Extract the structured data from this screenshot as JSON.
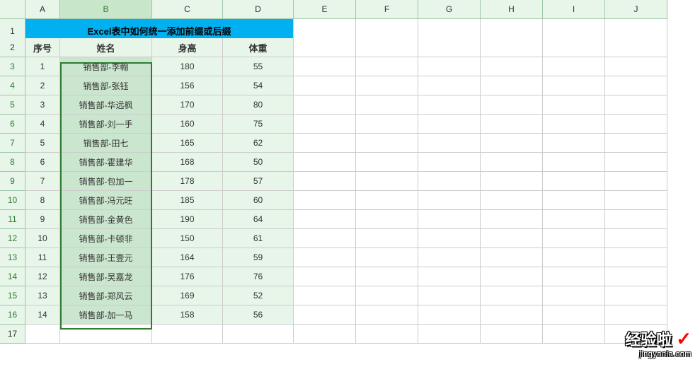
{
  "columns": [
    "A",
    "B",
    "C",
    "D",
    "E",
    "F",
    "G",
    "H",
    "I",
    "J"
  ],
  "selected_column": "B",
  "title": "Excel表中如何统一添加前缀或后缀",
  "headers": {
    "A": "序号",
    "B": "姓名",
    "C": "身高",
    "D": "体重"
  },
  "rows": [
    {
      "num": 1,
      "id": "1",
      "name": "销售部-李翰",
      "height": "180",
      "weight": "55"
    },
    {
      "num": 2,
      "id": "2",
      "name": "销售部-张钰",
      "height": "156",
      "weight": "54"
    },
    {
      "num": 3,
      "id": "3",
      "name": "销售部-华远枫",
      "height": "170",
      "weight": "80"
    },
    {
      "num": 4,
      "id": "4",
      "name": "销售部-刘一手",
      "height": "160",
      "weight": "75"
    },
    {
      "num": 5,
      "id": "5",
      "name": "销售部-田七",
      "height": "165",
      "weight": "62"
    },
    {
      "num": 6,
      "id": "6",
      "name": "销售部-霍建华",
      "height": "168",
      "weight": "50"
    },
    {
      "num": 7,
      "id": "7",
      "name": "销售部-包加一",
      "height": "178",
      "weight": "57"
    },
    {
      "num": 8,
      "id": "8",
      "name": "销售部-冯元旺",
      "height": "185",
      "weight": "60"
    },
    {
      "num": 9,
      "id": "9",
      "name": "销售部-金黄色",
      "height": "190",
      "weight": "64"
    },
    {
      "num": 10,
      "id": "10",
      "name": "销售部-卡顿非",
      "height": "150",
      "weight": "61"
    },
    {
      "num": 11,
      "id": "11",
      "name": "销售部-王壹元",
      "height": "164",
      "weight": "59"
    },
    {
      "num": 12,
      "id": "12",
      "name": "销售部-吴嘉龙",
      "height": "176",
      "weight": "76"
    },
    {
      "num": 13,
      "id": "13",
      "name": "销售部-郑风云",
      "height": "169",
      "weight": "52"
    },
    {
      "num": 14,
      "id": "14",
      "name": "销售部-加一马",
      "height": "158",
      "weight": "56"
    }
  ],
  "row_numbers": [
    1,
    2,
    3,
    4,
    5,
    6,
    7,
    8,
    9,
    10,
    11,
    12,
    13,
    14,
    15,
    16,
    17
  ],
  "selected_rows_start": 3,
  "selected_rows_end": 16,
  "watermark": {
    "title": "经验啦",
    "url": "jingyanla.com"
  }
}
